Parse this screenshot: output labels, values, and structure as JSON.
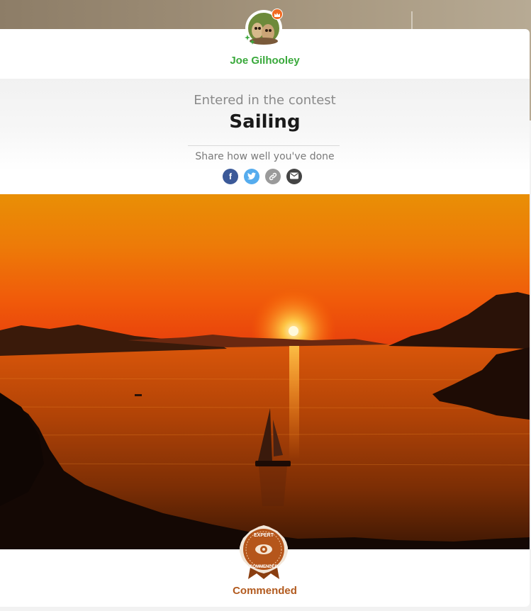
{
  "user": {
    "name": "Joe Gilhooley",
    "avatar_icon": "owls-avatar",
    "badge_icons": [
      "crown-icon",
      "sparkle-icon"
    ]
  },
  "contest": {
    "entered_label": "Entered in the contest",
    "title": "Sailing",
    "share_label": "Share how well you've done",
    "share_buttons": [
      {
        "name": "facebook",
        "glyph": "f",
        "color": "#3b5998"
      },
      {
        "name": "twitter",
        "glyph": "",
        "color": "#55acee"
      },
      {
        "name": "link",
        "glyph": "",
        "color": "#9a9a9a"
      },
      {
        "name": "email",
        "glyph": "",
        "color": "#444444"
      }
    ]
  },
  "photo": {
    "subject": "sunset-sailboat-photo"
  },
  "award": {
    "label": "Commended",
    "badge_text_top": "EXPERT",
    "badge_text_bottom": "COMMENDED",
    "color": "#b25a1e"
  },
  "colors": {
    "user_name": "#39a93b",
    "award": "#b25a1e"
  }
}
